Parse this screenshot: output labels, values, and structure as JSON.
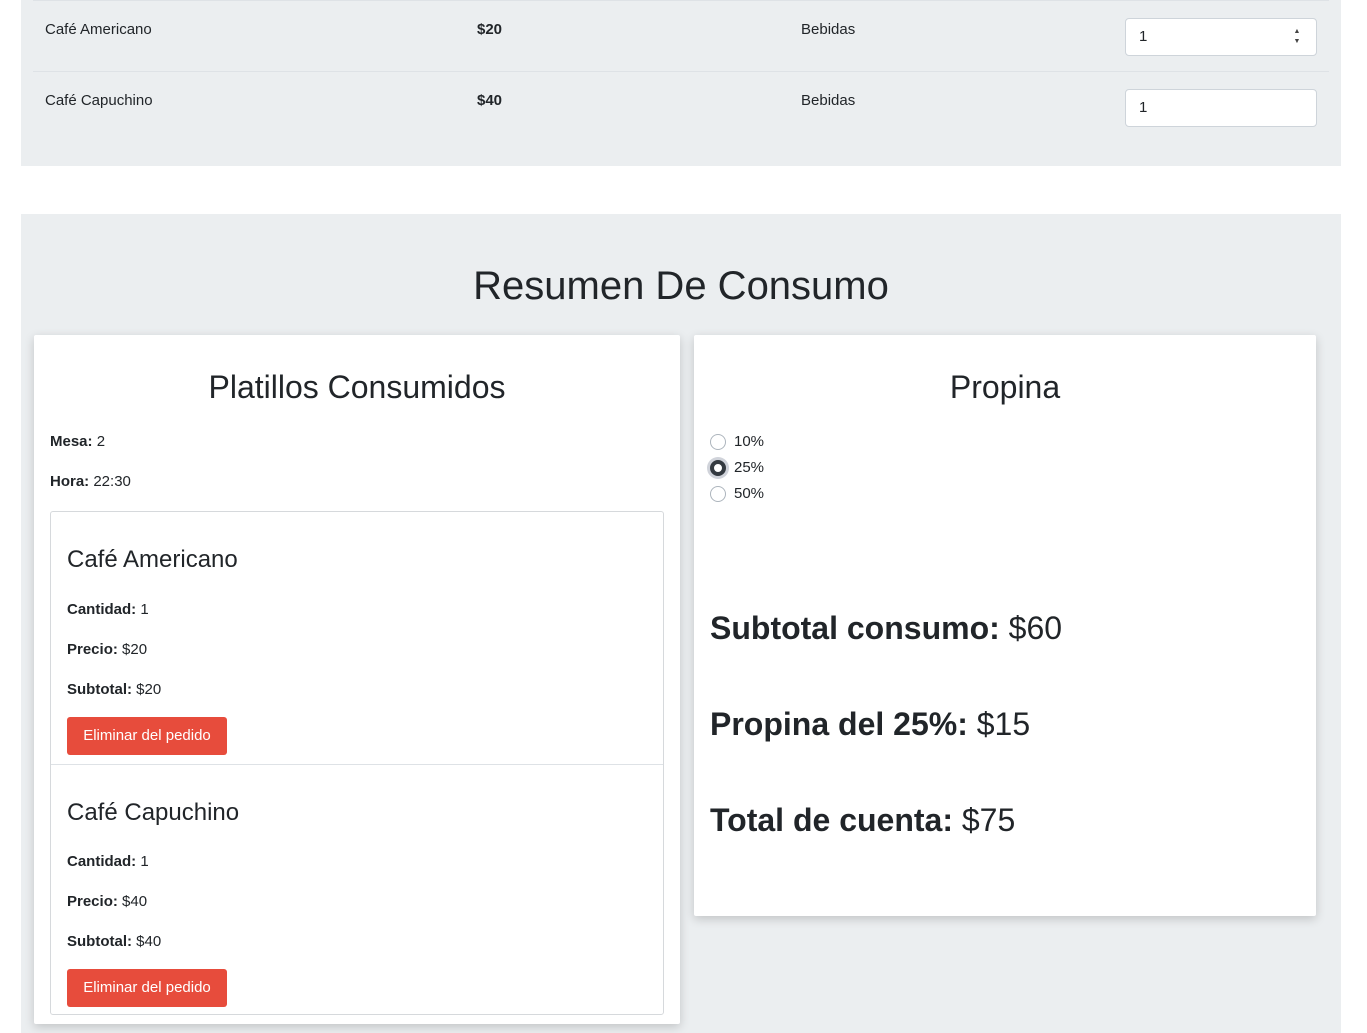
{
  "menu_rows": [
    {
      "name": "Café Americano",
      "price": "$20",
      "category": "Bebidas",
      "quantity": "1"
    },
    {
      "name": "Café Capuchino",
      "price": "$40",
      "category": "Bebidas",
      "quantity": "1"
    }
  ],
  "summary": {
    "title": "Resumen De Consumo",
    "consumed": {
      "title": "Platillos Consumidos",
      "mesa_label": "Mesa:",
      "mesa_value": "2",
      "hora_label": "Hora:",
      "hora_value": "22:30",
      "items": [
        {
          "name": "Café Americano",
          "cantidad_label": "Cantidad:",
          "cantidad": "1",
          "precio_label": "Precio:",
          "precio": "$20",
          "subtotal_label": "Subtotal:",
          "subtotal": "$20",
          "remove_label": "Eliminar del pedido"
        },
        {
          "name": "Café Capuchino",
          "cantidad_label": "Cantidad:",
          "cantidad": "1",
          "precio_label": "Precio:",
          "precio": "$40",
          "subtotal_label": "Subtotal:",
          "subtotal": "$40",
          "remove_label": "Eliminar del pedido"
        }
      ]
    },
    "tip": {
      "title": "Propina",
      "options": [
        "10%",
        "25%",
        "50%"
      ],
      "selected": "25%",
      "subtotal_label": "Subtotal consumo:",
      "subtotal_value": "$60",
      "tip_label": "Propina del 25%:",
      "tip_value": "$15",
      "total_label": "Total de cuenta:",
      "total_value": "$75"
    }
  },
  "colors": {
    "section_bg": "#ebeef0",
    "remove_button": "#e74c3c"
  }
}
